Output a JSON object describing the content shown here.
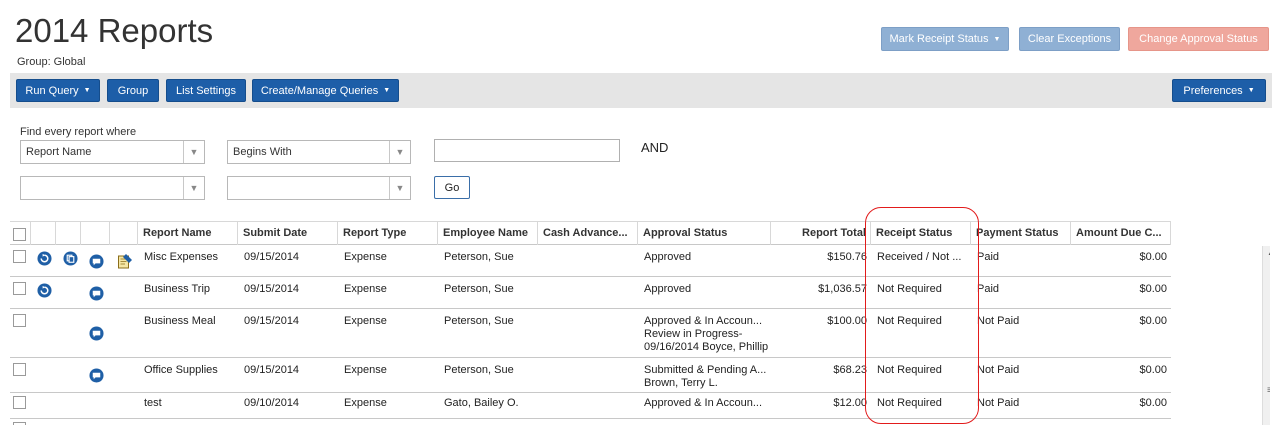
{
  "header": {
    "title": "2014 Reports",
    "group": "Group: Global"
  },
  "top_buttons": {
    "mark_receipt": "Mark Receipt Status",
    "clear_exceptions": "Clear Exceptions",
    "change_approval": "Change Approval Status"
  },
  "toolbar": {
    "run_query": "Run Query",
    "group": "Group",
    "list_settings": "List Settings",
    "create_manage": "Create/Manage Queries",
    "preferences": "Preferences"
  },
  "query": {
    "find_label": "Find every report where",
    "field": "Report Name",
    "operator": "Begins With",
    "value": "",
    "conjunction": "AND",
    "field2": "",
    "operator2": "",
    "go": "Go"
  },
  "columns": [
    "Report Name",
    "Submit Date",
    "Report Type",
    "Employee Name",
    "Cash Advance...",
    "Approval Status",
    "Report Total",
    "Receipt Status",
    "Payment Status",
    "Amount Due C..."
  ],
  "rows": [
    {
      "report_name": "Misc Expenses",
      "submit_date": "09/15/2014",
      "report_type": "Expense",
      "employee": "Peterson, Sue",
      "cash_advance": "",
      "approval_1": "Approved",
      "approval_2": "",
      "approval_3": "",
      "total": "$150.76",
      "receipt": "Received / Not ...",
      "payment": "Paid",
      "amount_due": "$0.00"
    },
    {
      "report_name": "Business Trip",
      "submit_date": "09/15/2014",
      "report_type": "Expense",
      "employee": "Peterson, Sue",
      "cash_advance": "",
      "approval_1": "Approved",
      "approval_2": "",
      "approval_3": "",
      "total": "$1,036.57",
      "receipt": "Not Required",
      "payment": "Paid",
      "amount_due": "$0.00"
    },
    {
      "report_name": "Business Meal",
      "submit_date": "09/15/2014",
      "report_type": "Expense",
      "employee": "Peterson, Sue",
      "cash_advance": "",
      "approval_1": "Approved & In Accoun...",
      "approval_2": "Review in Progress-",
      "approval_3": "09/16/2014 Boyce, Phillip",
      "total": "$100.00",
      "receipt": "Not Required",
      "payment": "Not Paid",
      "amount_due": "$0.00"
    },
    {
      "report_name": "Office Supplies",
      "submit_date": "09/15/2014",
      "report_type": "Expense",
      "employee": "Peterson, Sue",
      "cash_advance": "",
      "approval_1": "Submitted & Pending A...",
      "approval_2": "Brown, Terry L.",
      "approval_3": "",
      "total": "$68.23",
      "receipt": "Not Required",
      "payment": "Not Paid",
      "amount_due": "$0.00"
    },
    {
      "report_name": "test",
      "submit_date": "09/10/2014",
      "report_type": "Expense",
      "employee": "Gato, Bailey O.",
      "cash_advance": "",
      "approval_1": "Approved & In Accoun...",
      "approval_2": "",
      "approval_3": "",
      "total": "$12.00",
      "receipt": "Not Required",
      "payment": "Not Paid",
      "amount_due": "$0.00"
    }
  ],
  "colors": {
    "primary_button": "#1d5ea8",
    "disabled_button": "#8fb0d4",
    "warning_button": "#efa79d",
    "highlight": "#e21b1b",
    "icon_blue": "#1f5fa6"
  }
}
